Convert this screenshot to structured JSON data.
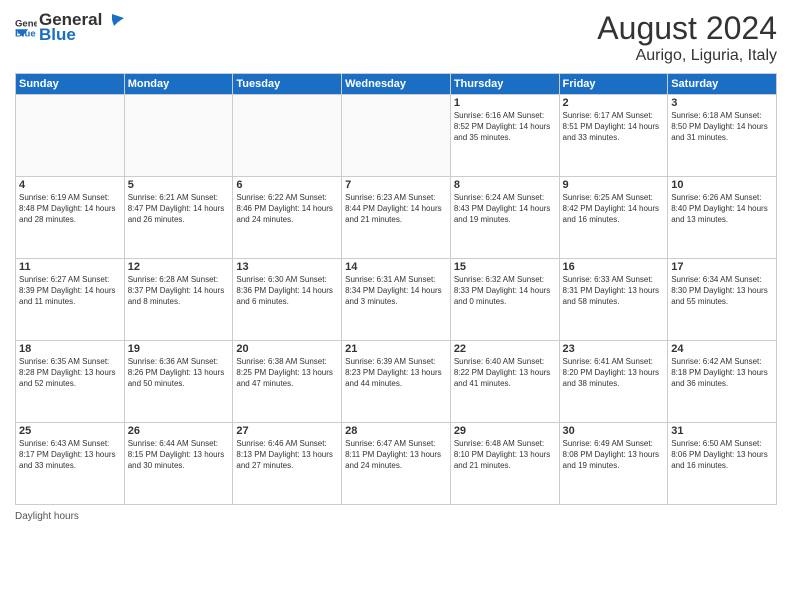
{
  "header": {
    "logo_general": "General",
    "logo_blue": "Blue",
    "month_title": "August 2024",
    "location": "Aurigo, Liguria, Italy"
  },
  "days_of_week": [
    "Sunday",
    "Monday",
    "Tuesday",
    "Wednesday",
    "Thursday",
    "Friday",
    "Saturday"
  ],
  "footer_label": "Daylight hours",
  "weeks": [
    [
      {
        "day": "",
        "info": ""
      },
      {
        "day": "",
        "info": ""
      },
      {
        "day": "",
        "info": ""
      },
      {
        "day": "",
        "info": ""
      },
      {
        "day": "1",
        "info": "Sunrise: 6:16 AM\nSunset: 8:52 PM\nDaylight: 14 hours and 35 minutes."
      },
      {
        "day": "2",
        "info": "Sunrise: 6:17 AM\nSunset: 8:51 PM\nDaylight: 14 hours and 33 minutes."
      },
      {
        "day": "3",
        "info": "Sunrise: 6:18 AM\nSunset: 8:50 PM\nDaylight: 14 hours and 31 minutes."
      }
    ],
    [
      {
        "day": "4",
        "info": "Sunrise: 6:19 AM\nSunset: 8:48 PM\nDaylight: 14 hours and 28 minutes."
      },
      {
        "day": "5",
        "info": "Sunrise: 6:21 AM\nSunset: 8:47 PM\nDaylight: 14 hours and 26 minutes."
      },
      {
        "day": "6",
        "info": "Sunrise: 6:22 AM\nSunset: 8:46 PM\nDaylight: 14 hours and 24 minutes."
      },
      {
        "day": "7",
        "info": "Sunrise: 6:23 AM\nSunset: 8:44 PM\nDaylight: 14 hours and 21 minutes."
      },
      {
        "day": "8",
        "info": "Sunrise: 6:24 AM\nSunset: 8:43 PM\nDaylight: 14 hours and 19 minutes."
      },
      {
        "day": "9",
        "info": "Sunrise: 6:25 AM\nSunset: 8:42 PM\nDaylight: 14 hours and 16 minutes."
      },
      {
        "day": "10",
        "info": "Sunrise: 6:26 AM\nSunset: 8:40 PM\nDaylight: 14 hours and 13 minutes."
      }
    ],
    [
      {
        "day": "11",
        "info": "Sunrise: 6:27 AM\nSunset: 8:39 PM\nDaylight: 14 hours and 11 minutes."
      },
      {
        "day": "12",
        "info": "Sunrise: 6:28 AM\nSunset: 8:37 PM\nDaylight: 14 hours and 8 minutes."
      },
      {
        "day": "13",
        "info": "Sunrise: 6:30 AM\nSunset: 8:36 PM\nDaylight: 14 hours and 6 minutes."
      },
      {
        "day": "14",
        "info": "Sunrise: 6:31 AM\nSunset: 8:34 PM\nDaylight: 14 hours and 3 minutes."
      },
      {
        "day": "15",
        "info": "Sunrise: 6:32 AM\nSunset: 8:33 PM\nDaylight: 14 hours and 0 minutes."
      },
      {
        "day": "16",
        "info": "Sunrise: 6:33 AM\nSunset: 8:31 PM\nDaylight: 13 hours and 58 minutes."
      },
      {
        "day": "17",
        "info": "Sunrise: 6:34 AM\nSunset: 8:30 PM\nDaylight: 13 hours and 55 minutes."
      }
    ],
    [
      {
        "day": "18",
        "info": "Sunrise: 6:35 AM\nSunset: 8:28 PM\nDaylight: 13 hours and 52 minutes."
      },
      {
        "day": "19",
        "info": "Sunrise: 6:36 AM\nSunset: 8:26 PM\nDaylight: 13 hours and 50 minutes."
      },
      {
        "day": "20",
        "info": "Sunrise: 6:38 AM\nSunset: 8:25 PM\nDaylight: 13 hours and 47 minutes."
      },
      {
        "day": "21",
        "info": "Sunrise: 6:39 AM\nSunset: 8:23 PM\nDaylight: 13 hours and 44 minutes."
      },
      {
        "day": "22",
        "info": "Sunrise: 6:40 AM\nSunset: 8:22 PM\nDaylight: 13 hours and 41 minutes."
      },
      {
        "day": "23",
        "info": "Sunrise: 6:41 AM\nSunset: 8:20 PM\nDaylight: 13 hours and 38 minutes."
      },
      {
        "day": "24",
        "info": "Sunrise: 6:42 AM\nSunset: 8:18 PM\nDaylight: 13 hours and 36 minutes."
      }
    ],
    [
      {
        "day": "25",
        "info": "Sunrise: 6:43 AM\nSunset: 8:17 PM\nDaylight: 13 hours and 33 minutes."
      },
      {
        "day": "26",
        "info": "Sunrise: 6:44 AM\nSunset: 8:15 PM\nDaylight: 13 hours and 30 minutes."
      },
      {
        "day": "27",
        "info": "Sunrise: 6:46 AM\nSunset: 8:13 PM\nDaylight: 13 hours and 27 minutes."
      },
      {
        "day": "28",
        "info": "Sunrise: 6:47 AM\nSunset: 8:11 PM\nDaylight: 13 hours and 24 minutes."
      },
      {
        "day": "29",
        "info": "Sunrise: 6:48 AM\nSunset: 8:10 PM\nDaylight: 13 hours and 21 minutes."
      },
      {
        "day": "30",
        "info": "Sunrise: 6:49 AM\nSunset: 8:08 PM\nDaylight: 13 hours and 19 minutes."
      },
      {
        "day": "31",
        "info": "Sunrise: 6:50 AM\nSunset: 8:06 PM\nDaylight: 13 hours and 16 minutes."
      }
    ]
  ]
}
